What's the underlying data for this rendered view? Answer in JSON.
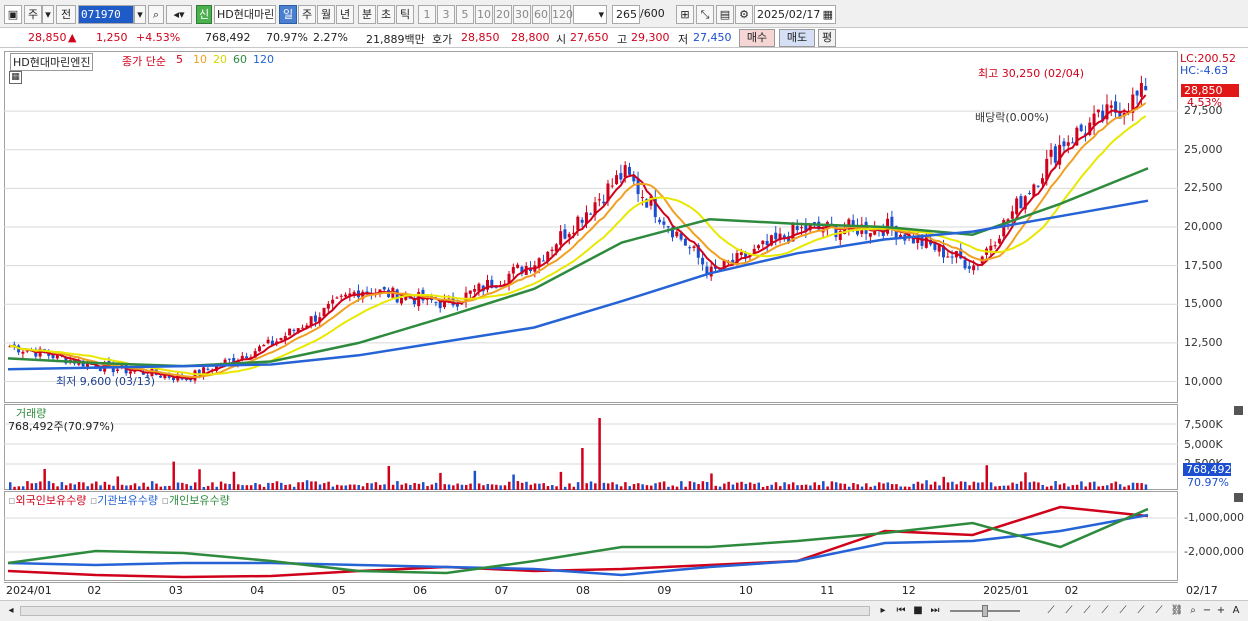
{
  "toolbar": {
    "btn_ju": "주",
    "btn_jeon": "전",
    "code": "071970",
    "btn_shin": "신",
    "stock_name": "HD현대마린",
    "periods": [
      "일",
      "주",
      "월",
      "년",
      "분",
      "초",
      "틱"
    ],
    "nums": [
      "1",
      "3",
      "5",
      "10",
      "20",
      "30",
      "60",
      "120"
    ],
    "count": "265",
    "count_total": "/600",
    "date": "2025/02/17"
  },
  "quote": {
    "price": "28,850",
    "change_arrow": "▲",
    "change": "1,250",
    "change_pct": "+4.53%",
    "volume": "768,492",
    "vol_ratio": "70.97%",
    "turnover": "2.27%",
    "amount": "21,889백만",
    "hoga_label": "호가",
    "ask": "28,850",
    "bid": "28,800",
    "open_label": "시",
    "open": "27,650",
    "high_label": "고",
    "high": "29,300",
    "low_label": "저",
    "low": "27,450",
    "buy": "매수",
    "sell": "매도",
    "pyeong": "평"
  },
  "price_panel": {
    "stock_tag": "HD현대마린엔진",
    "ma_label": "종가 단순",
    "ma_periods": [
      "5",
      "10",
      "20",
      "60",
      "120"
    ],
    "ma_colors": [
      "#d0021b",
      "#f0a020",
      "#e8e800",
      "#2e8b3e",
      "#2563d6"
    ],
    "lc": "LC:200.52",
    "hc": "HC:-4.63",
    "last_price_tag": "28,850",
    "last_pct_tag": "4.53%",
    "max_label": "최고 30,250 (02/04)",
    "min_label": "최저 9,600 (03/13)",
    "dividend_label": "배당락(0.00%)",
    "yticks": [
      "27,500",
      "25,000",
      "22,500",
      "20,000",
      "17,500",
      "15,000",
      "12,500",
      "10,000"
    ]
  },
  "volume_panel": {
    "title": "거래량",
    "value": "768,492주(70.97%)",
    "yticks": [
      "7,500K",
      "5,000K",
      "2,500K"
    ],
    "vol_tag": "768,492",
    "pct_tag": "70.97%"
  },
  "holding_panel": {
    "legends": [
      "외국인보유수량",
      "기관보유수량",
      "개인보유수량"
    ],
    "legend_colors": [
      "#d0021b",
      "#2563d6",
      "#2e8b3e"
    ],
    "yticks": [
      "-1,000,000",
      "-2,000,000"
    ]
  },
  "xaxis": {
    "labels": [
      "2024/01",
      "02",
      "03",
      "04",
      "05",
      "06",
      "07",
      "08",
      "09",
      "10",
      "11",
      "12",
      "2025/01",
      "02"
    ],
    "right_label": "02/17"
  },
  "colors": {
    "up": "#d0021b",
    "down": "#1b4fcf",
    "grid": "#d9d9d9"
  },
  "chart_data": {
    "type": "candlestick",
    "title": "HD현대마린엔진",
    "y_range": [
      9000,
      31000
    ],
    "months": [
      "2024/01",
      "02",
      "03",
      "04",
      "05",
      "06",
      "07",
      "08",
      "09",
      "10",
      "11",
      "12",
      "2025/01",
      "02"
    ],
    "monthly_close_approx": [
      12300,
      11000,
      10200,
      12500,
      16000,
      15000,
      17800,
      23500,
      17000,
      19800,
      20000,
      17500,
      25500,
      28850
    ],
    "series": [
      {
        "name": "5",
        "kind": "ma"
      },
      {
        "name": "10",
        "kind": "ma"
      },
      {
        "name": "20",
        "kind": "ma"
      },
      {
        "name": "60",
        "kind": "ma",
        "values_monthly": [
          11500,
          11200,
          11000,
          11300,
          12500,
          14200,
          16000,
          19000,
          20500,
          20200,
          20000,
          19500,
          21500,
          23800
        ]
      },
      {
        "name": "120",
        "kind": "ma",
        "values_monthly": [
          10800,
          10900,
          11000,
          11100,
          11700,
          12600,
          13500,
          15200,
          17000,
          18300,
          19200,
          19700,
          20700,
          21700
        ]
      }
    ],
    "max": {
      "value": 30250,
      "date": "02/04"
    },
    "min": {
      "value": 9600,
      "date": "03/13"
    },
    "last": 28850
  }
}
